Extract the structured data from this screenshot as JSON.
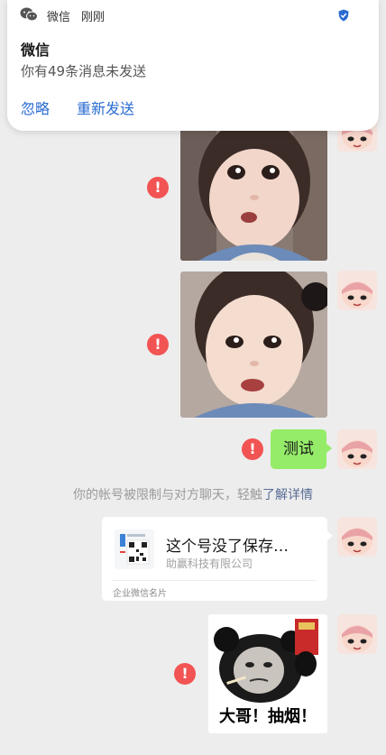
{
  "notification": {
    "app_name": "微信",
    "time": "刚刚",
    "title": "微信",
    "body": "你有49条消息未发送",
    "actions": {
      "ignore": "忽略",
      "resend": "重新发送"
    }
  },
  "chat": {
    "error_mark": "!",
    "text_message": "测试",
    "system_notice": {
      "text": "你的帐号被限制与对方聊天，轻触",
      "link": "了解详情"
    },
    "contact_card": {
      "title": "这个号没了保存…",
      "company": "助赢科技有限公司",
      "footer": "企业微信名片"
    },
    "sticker_caption": "大哥！抽烟！"
  },
  "colors": {
    "background": "#ededed",
    "bubble_green": "#95ec69",
    "error_red": "#f25353",
    "link_blue": "#576b95",
    "action_blue": "#2a6bd1"
  }
}
